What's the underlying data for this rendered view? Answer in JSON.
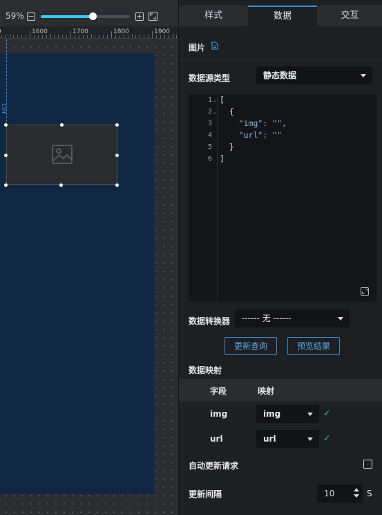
{
  "toolbar": {
    "zoom_label": "59%",
    "zoom_fraction": 0.59,
    "minus_label": "−",
    "plus_label": "+"
  },
  "ruler": {
    "ticks": [
      "1600",
      "1700",
      "1800",
      "1900"
    ]
  },
  "canvas": {
    "guide_label": "134"
  },
  "tabs": [
    {
      "label": "样式",
      "active": false
    },
    {
      "label": "数据",
      "active": true
    },
    {
      "label": "交互",
      "active": false
    }
  ],
  "component": {
    "title": "图片"
  },
  "datasource": {
    "label": "数据源类型",
    "value": "静态数据"
  },
  "editor": {
    "line_numbers": [
      "1",
      "2",
      "3",
      "4",
      "5",
      "6"
    ],
    "folds": [
      "1",
      "2"
    ],
    "lines": [
      "[",
      "  {",
      "    \"img\": \"\",",
      "    \"url\": \"\"",
      "  }",
      "]"
    ]
  },
  "converter": {
    "label": "数据转换器",
    "value": "------ 无 ------"
  },
  "buttons": {
    "refresh": "更新查询",
    "preview": "预览结果"
  },
  "mapping": {
    "title": "数据映射",
    "col_field": "字段",
    "col_map": "映射",
    "rows": [
      {
        "field": "img",
        "value": "img"
      },
      {
        "field": "url",
        "value": "url"
      }
    ]
  },
  "auto_update": {
    "label": "自动更新请求",
    "checked": false
  },
  "interval": {
    "label": "更新间隔",
    "value": "10",
    "unit": "S"
  },
  "colors": {
    "accent": "#3a8fd6",
    "screen": "#112844",
    "check": "#2fbf71"
  }
}
